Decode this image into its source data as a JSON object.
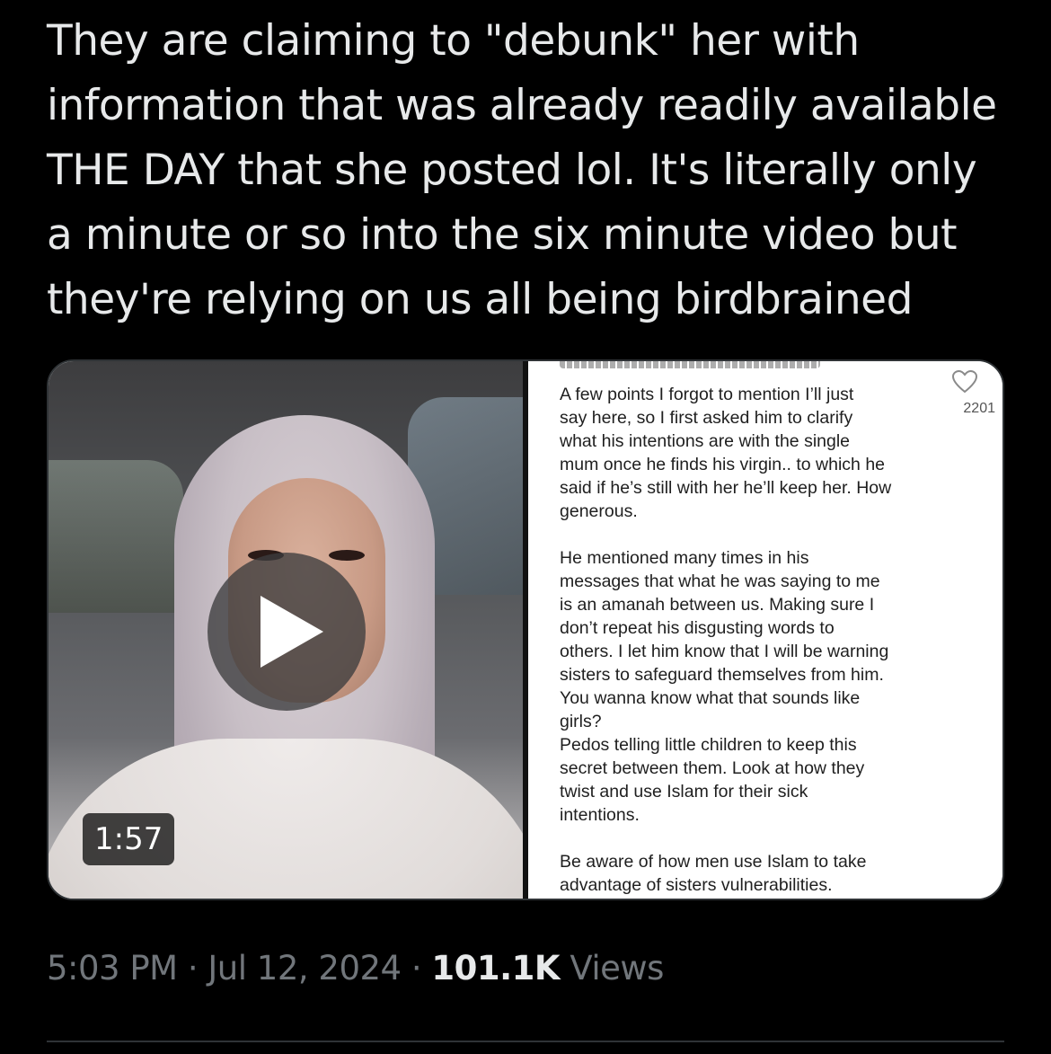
{
  "tweet": {
    "text_lines": [
      "They are claiming to \"debunk\" her with",
      "information that was already readily available",
      "THE DAY that she posted lol. It's literally only",
      "a minute or so into the six minute video but",
      "they're relying on us all being birdbrained"
    ]
  },
  "media": {
    "video": {
      "duration": "1:57",
      "play_icon": "play-icon"
    },
    "screenshot": {
      "like_count": "2201",
      "heart_icon": "heart-icon",
      "paragraph1": [
        "A few points I forgot to mention I’ll just",
        "say here, so I first asked him to clarify",
        "what his intentions are with the single",
        "mum once he finds his virgin.. to which he",
        "said if he’s still with her he’ll keep her. How",
        "generous."
      ],
      "paragraph2": [
        "He mentioned many times in his",
        "messages that what he was saying to me",
        "is an amanah between us. Making sure I",
        "don’t repeat his disgusting words to",
        "others. I let him know that I will be warning",
        "sisters to safeguard themselves from him.",
        "You wanna know what that sounds like",
        "girls?",
        "Pedos telling little children to keep this",
        "secret between them. Look at how they",
        "twist and use Islam for their sick",
        "intentions."
      ],
      "paragraph3": [
        "Be aware of how men use Islam to take",
        "advantage of sisters vulnerabilities."
      ]
    }
  },
  "meta": {
    "time": "5:03 PM",
    "separator": " · ",
    "date": "Jul 12, 2024",
    "views_count": "101.1K",
    "views_label": "Views"
  },
  "colors": {
    "background": "#000000",
    "text_primary": "#e7e9ea",
    "text_secondary": "#71767b",
    "border": "#2f3336"
  }
}
